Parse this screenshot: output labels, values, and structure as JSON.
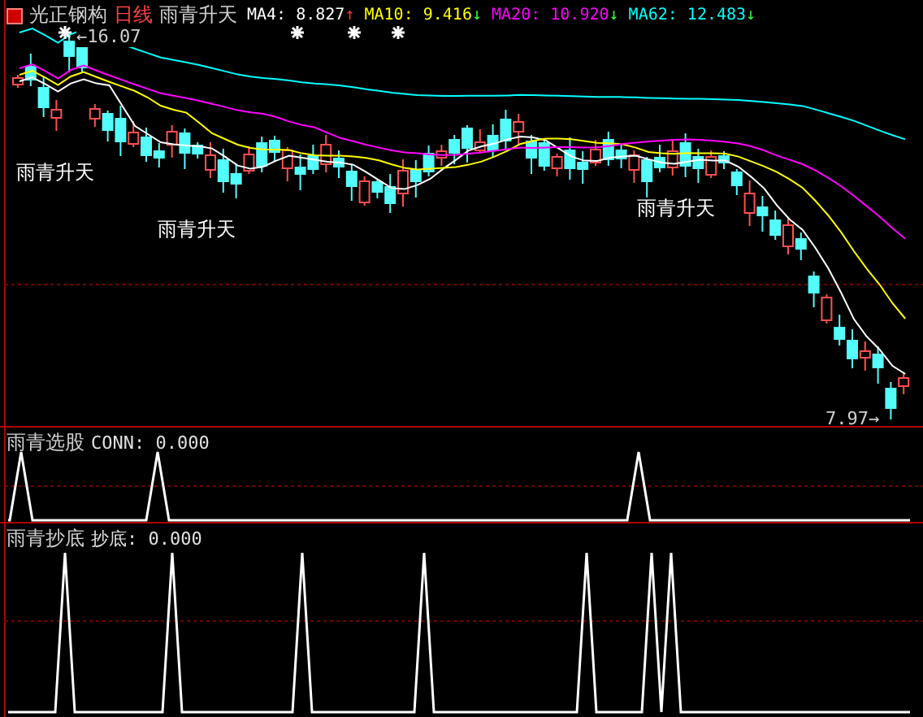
{
  "main_panel": {
    "stock_name": "光正钢构",
    "period": "日线",
    "indicator": "雨青升天",
    "ma_readings": [
      {
        "label": "MA4: 8.827",
        "arrow": "↑",
        "kind": "up",
        "color": "#ffffff"
      },
      {
        "label": "MA10: 9.416",
        "arrow": "↓",
        "kind": "down",
        "color": "#ffff00"
      },
      {
        "label": "MA20: 10.920",
        "arrow": "↓",
        "kind": "down",
        "color": "#ff00ff"
      },
      {
        "label": "MA62: 12.483",
        "arrow": "↓",
        "kind": "down",
        "color": "#00ffff"
      }
    ],
    "high_label": "←16.07",
    "low_label": "7.97→",
    "signal_labels": [
      "雨青升天",
      "雨青升天",
      "雨青升天"
    ]
  },
  "panel_2": {
    "title": "雨青选股",
    "reading": "CONN: 0.000"
  },
  "panel_3": {
    "title": "雨青抄底",
    "reading": "抄底: 0.000"
  }
}
